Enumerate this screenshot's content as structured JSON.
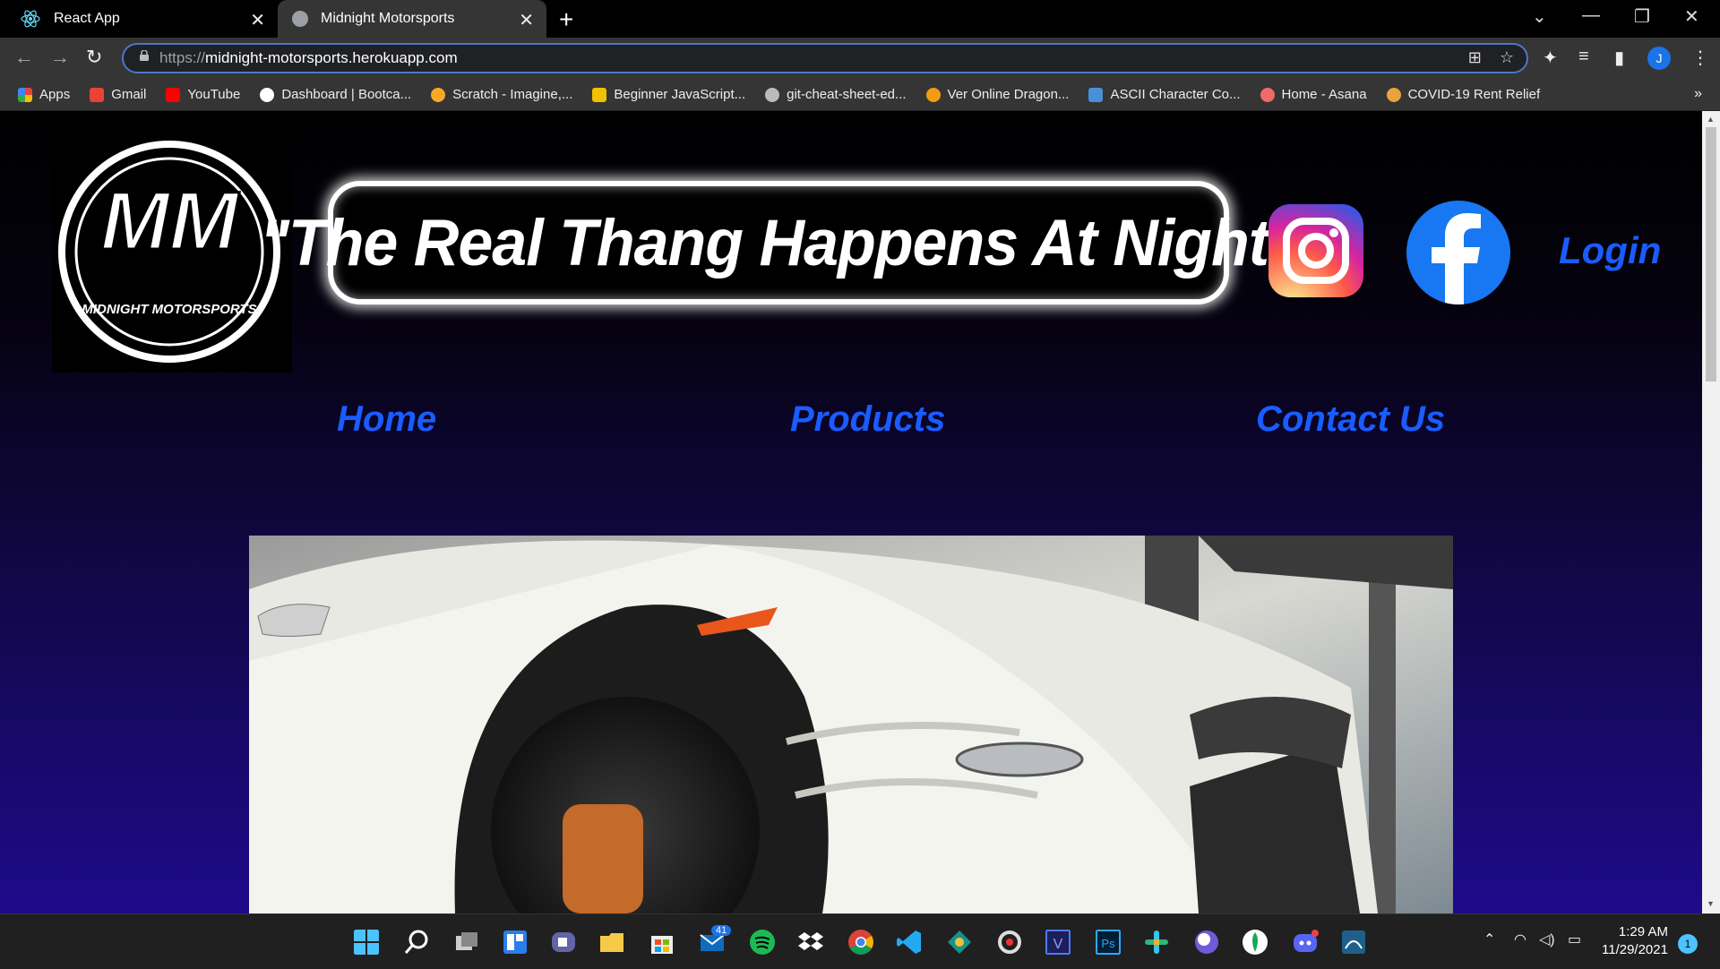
{
  "browser": {
    "tabs": [
      {
        "title": "React App",
        "close": "✕"
      },
      {
        "title": "Midnight Motorsports",
        "close": "✕"
      }
    ],
    "new_tab": "+",
    "url_prefix": "https://",
    "url_host": "midnight-motorsports.herokuapp.com",
    "avatar_initial": "J",
    "bookmarks": [
      {
        "label": "Apps",
        "color": "#4285f4"
      },
      {
        "label": "Gmail",
        "color": "#ea4335"
      },
      {
        "label": "YouTube",
        "color": "#ff0000"
      },
      {
        "label": "Dashboard | Bootca...",
        "color": "#ffffff"
      },
      {
        "label": "Scratch - Imagine,...",
        "color": "#f9a825"
      },
      {
        "label": "Beginner JavaScript...",
        "color": "#f2c200"
      },
      {
        "label": "git-cheat-sheet-ed...",
        "color": "#bbbbbb"
      },
      {
        "label": "Ver Online Dragon...",
        "color": "#f39c12"
      },
      {
        "label": "ASCII Character Co...",
        "color": "#4a90d9"
      },
      {
        "label": "Home - Asana",
        "color": "#f06a6a"
      },
      {
        "label": "COVID-19 Rent Relief",
        "color": "#e8a33d"
      }
    ],
    "bookmarks_more": "»"
  },
  "site": {
    "logo_text": "MM",
    "logo_caption": "MIDNIGHT MOTORSPORTS",
    "slogan": "\"The Real Thang Happens At Night\"",
    "login": "Login",
    "nav": [
      "Home",
      "Products",
      "Contact Us"
    ],
    "hero_icon": "sports-car-photo"
  },
  "taskbar": {
    "mail_badge": "41",
    "time": "1:29 AM",
    "date": "11/29/2021",
    "notifications": "1"
  }
}
